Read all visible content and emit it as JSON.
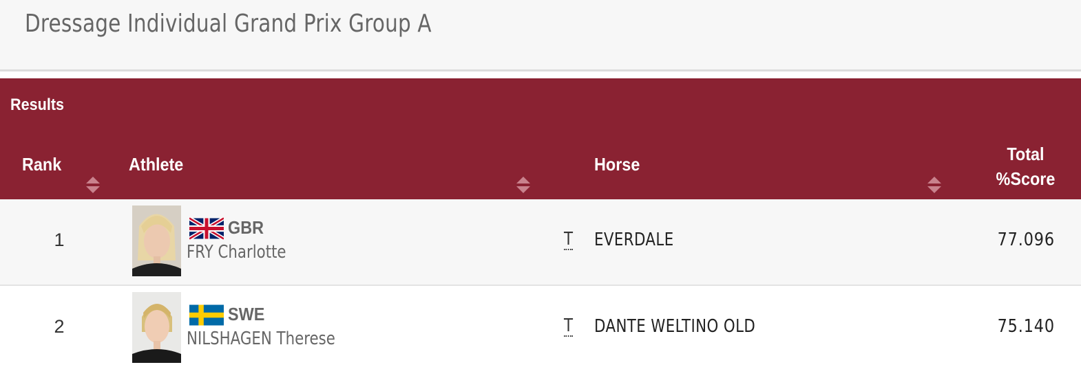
{
  "page": {
    "title": "Dressage Individual Grand Prix Group A"
  },
  "results": {
    "label": "Results",
    "columns": {
      "rank": "Rank",
      "athlete": "Athlete",
      "horse": "Horse",
      "total_line1": "Total",
      "total_line2": "%Score"
    },
    "rows": [
      {
        "rank": "1",
        "noc": "GBR",
        "flag_icon": "gbr-flag-icon",
        "athlete": "FRY Charlotte",
        "team_marker": "T",
        "horse": "EVERDALE",
        "score": "77.096"
      },
      {
        "rank": "2",
        "noc": "SWE",
        "flag_icon": "swe-flag-icon",
        "athlete": "NILSHAGEN Therese",
        "team_marker": "T",
        "horse": "DANTE WELTINO OLD",
        "score": "75.140"
      }
    ]
  },
  "colors": {
    "header_bg": "#8a2232",
    "title_text": "#666666",
    "row_alt_bg": "#f7f7f7"
  }
}
